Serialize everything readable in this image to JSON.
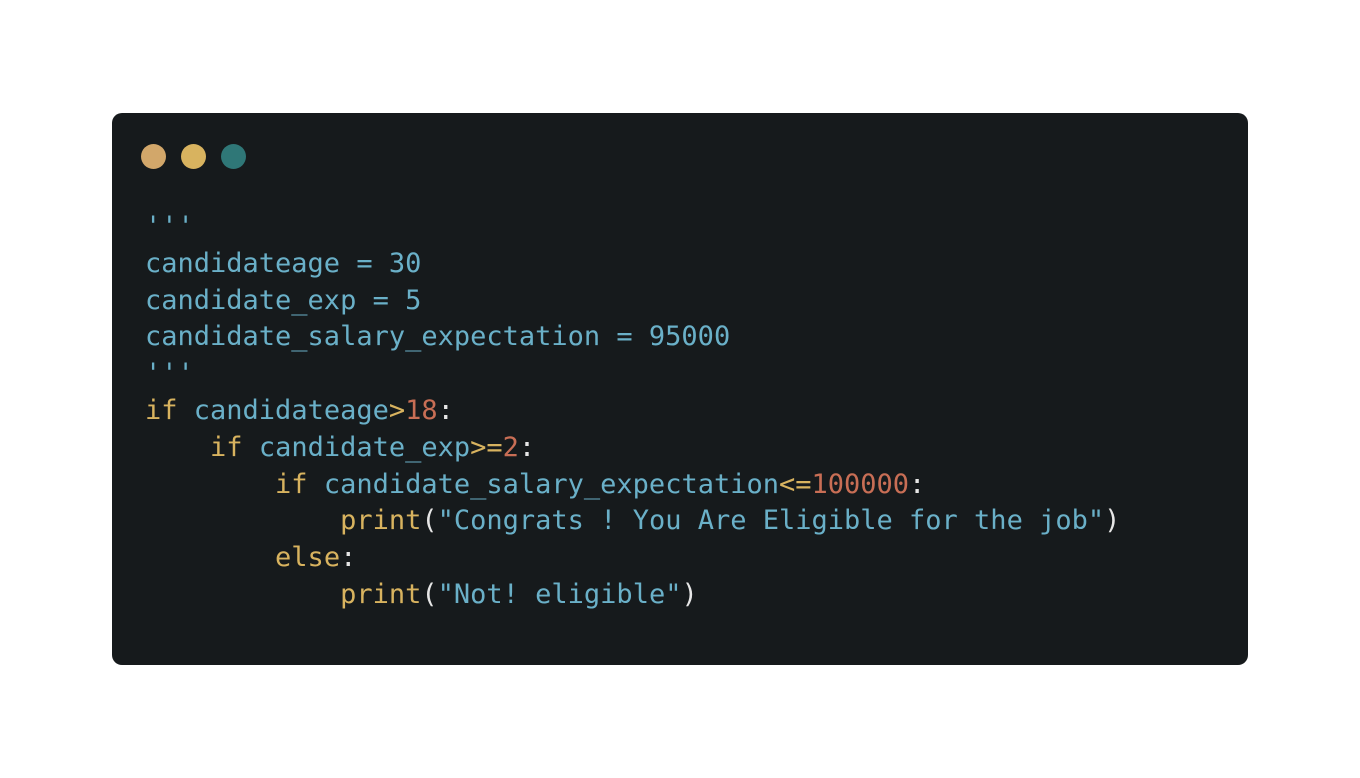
{
  "window": {
    "dots": [
      {
        "name": "close",
        "color": "#d2a76a"
      },
      {
        "name": "minimize",
        "color": "#d8b35f"
      },
      {
        "name": "maximize",
        "color": "#2f7777"
      }
    ],
    "background": "#161a1c"
  },
  "colors": {
    "keyword": "#d8b35f",
    "identifier": "#6ab0c8",
    "number": "#c86e55",
    "punctuation": "#e6e6e6"
  },
  "code": {
    "lines": [
      [
        {
          "t": "doc",
          "v": "'''"
        }
      ],
      [
        {
          "t": "id",
          "v": "candidateage = 30"
        }
      ],
      [
        {
          "t": "id",
          "v": "candidate_exp = 5"
        }
      ],
      [
        {
          "t": "id",
          "v": "candidate_salary_expectation = 95000"
        }
      ],
      [
        {
          "t": "doc",
          "v": "'''"
        }
      ],
      [
        {
          "t": "kw",
          "v": "if"
        },
        {
          "t": "plain",
          "v": " "
        },
        {
          "t": "id",
          "v": "candidateage"
        },
        {
          "t": "op",
          "v": ">"
        },
        {
          "t": "num",
          "v": "18"
        },
        {
          "t": "punc",
          "v": ":"
        }
      ],
      [
        {
          "t": "plain",
          "v": "    "
        },
        {
          "t": "kw",
          "v": "if"
        },
        {
          "t": "plain",
          "v": " "
        },
        {
          "t": "id",
          "v": "candidate_exp"
        },
        {
          "t": "op",
          "v": ">="
        },
        {
          "t": "num",
          "v": "2"
        },
        {
          "t": "punc",
          "v": ":"
        }
      ],
      [
        {
          "t": "plain",
          "v": "        "
        },
        {
          "t": "kw",
          "v": "if"
        },
        {
          "t": "plain",
          "v": " "
        },
        {
          "t": "id",
          "v": "candidate_salary_expectation"
        },
        {
          "t": "op",
          "v": "<="
        },
        {
          "t": "num",
          "v": "100000"
        },
        {
          "t": "punc",
          "v": ":"
        }
      ],
      [
        {
          "t": "plain",
          "v": "            "
        },
        {
          "t": "fn",
          "v": "print"
        },
        {
          "t": "punc",
          "v": "("
        },
        {
          "t": "str",
          "v": "\"Congrats ! You Are Eligible for the job\""
        },
        {
          "t": "punc",
          "v": ")"
        }
      ],
      [
        {
          "t": "plain",
          "v": "        "
        },
        {
          "t": "kw",
          "v": "else"
        },
        {
          "t": "punc",
          "v": ":"
        }
      ],
      [
        {
          "t": "plain",
          "v": "            "
        },
        {
          "t": "fn",
          "v": "print"
        },
        {
          "t": "punc",
          "v": "("
        },
        {
          "t": "str",
          "v": "\"Not! eligible\""
        },
        {
          "t": "punc",
          "v": ")"
        }
      ]
    ]
  }
}
